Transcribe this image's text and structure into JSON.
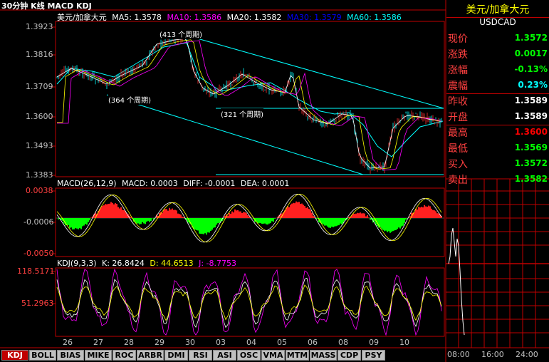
{
  "period_label": "30分钟 K线 MACD KDJ",
  "main": {
    "legend_name": "美元/加拿大元",
    "ma5_label": "MA5: 1.3578",
    "ma10_label": "MA10: 1.3586",
    "ma20_label": "MA20: 1.3582",
    "ma30_label": "MA30: 1.3579",
    "ma60_label": "MA60: 1.3586",
    "ticks": [
      "1.3923",
      "1.3816",
      "1.3709",
      "1.3600",
      "1.3493",
      "1.3383"
    ],
    "annotations": [
      "(413 个周期)",
      "(364 个周期)",
      "(321 个周期)"
    ]
  },
  "macd": {
    "label": "MACD(26,12,9)",
    "macd_val": "MACD: 0.0003",
    "diff_val": "DIFF: -0.0001",
    "dea_val": "DEA: 0.0001",
    "ticks": [
      "0.0038",
      "-0.0006",
      "-0.0050"
    ]
  },
  "kdj": {
    "label": "KDJ(9,3,3)",
    "k_val": "K: 26.8424",
    "d_val": "D: 44.6513",
    "j_val": "J: -8.7753",
    "ticks": [
      "118.5171",
      "51.2963"
    ]
  },
  "x_ticks": [
    "26",
    "27",
    "28",
    "29",
    "30",
    "03",
    "04",
    "05",
    "06",
    "08",
    "09",
    "10"
  ],
  "tabs": [
    "KDJ",
    "BOLL",
    "BIAS",
    "MIKE",
    "ROC",
    "ARBR",
    "DMI",
    "RSI",
    "ASI",
    "OSC",
    "VMA",
    "MTM",
    "MASS",
    "CDP",
    "PSY"
  ],
  "quote": {
    "title": "美元/加拿大元",
    "symbol": "USDCAD",
    "rows": [
      {
        "label": "现价",
        "value": "1.3572",
        "color": "#00ff00"
      },
      {
        "label": "涨跌",
        "value": "0.0017",
        "color": "#00ff00"
      },
      {
        "label": "涨幅",
        "value": "-0.13%",
        "color": "#00ff00"
      },
      {
        "label": "震幅",
        "value": "0.23%",
        "color": "#00ffff"
      },
      {
        "label": "昨收",
        "value": "1.3589",
        "color": "#ffffff"
      },
      {
        "label": "开盘",
        "value": "1.3589",
        "color": "#ffffff"
      },
      {
        "label": "最高",
        "value": "1.3600",
        "color": "#ff0000"
      },
      {
        "label": "最低",
        "value": "1.3569",
        "color": "#00ff00"
      },
      {
        "label": "买入",
        "value": "1.3572",
        "color": "#00ff00"
      },
      {
        "label": "卖出",
        "value": "1.3582",
        "color": "#00ff00"
      }
    ],
    "time_ticks": [
      "08:00",
      "16:00",
      "24:00"
    ]
  },
  "colors": {
    "grid": "#c00000",
    "up": "#ff3030",
    "down": "#00ff00",
    "cyan": "#00ffff",
    "yellow": "#ffff00",
    "magenta": "#ff00ff",
    "label_red": "#ff4040"
  }
}
